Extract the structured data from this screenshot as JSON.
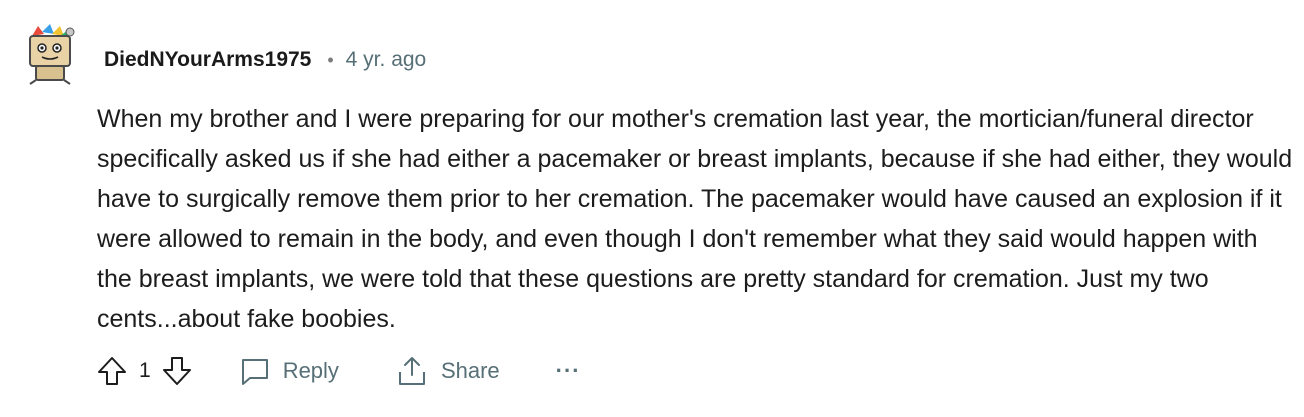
{
  "comment": {
    "author": "DiedNYourArms1975",
    "separator": "•",
    "timestamp": "4 yr. ago",
    "avatar_icon": "snoo-avatar-icon",
    "body": "When my brother and I were preparing for our mother's cremation last year, the mortician/funeral director specifically asked us if she had either a pacemaker or breast implants, because if she had either, they would have to surgically remove them prior to her cremation. The pacemaker would have caused an explosion if it were allowed to remain in the body, and even though I don't remember what they said would happen with the breast implants, we were told that these questions are pretty standard for cremation. Just my two cents...about fake boobies."
  },
  "actions": {
    "upvote_icon": "arrow-up-icon",
    "vote_count": "1",
    "downvote_icon": "arrow-down-icon",
    "reply_icon": "speech-bubble-icon",
    "reply_label": "Reply",
    "share_icon": "share-icon",
    "share_label": "Share",
    "more_label": "···"
  },
  "colors": {
    "text": "#1c1c1c",
    "muted": "#576f76",
    "background": "#ffffff"
  }
}
